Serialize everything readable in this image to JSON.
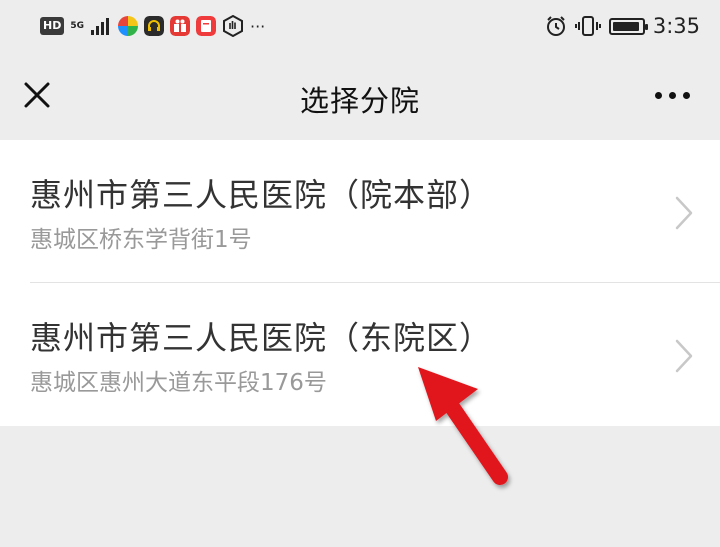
{
  "status_bar": {
    "network_badge": "HD",
    "network_type": "5G",
    "time": "3:35",
    "overflow_glyph": "···",
    "icons": [
      "signal-icon",
      "app-icon-colorful",
      "headphone-app-icon",
      "gift-app-icon",
      "book-app-icon",
      "hand-app-icon",
      "alarm-icon",
      "vibrate-icon",
      "battery-icon"
    ]
  },
  "nav_bar": {
    "title": "选择分院",
    "left_icon": "close-icon",
    "right_icon": "more-icon"
  },
  "branches": [
    {
      "name": "惠州市第三人民医院（院本部）",
      "address": "惠城区桥东学背街1号"
    },
    {
      "name": "惠州市第三人民医院（东院区）",
      "address": "惠城区惠州大道东平段176号"
    }
  ],
  "colors": {
    "background": "#ededed",
    "list_background": "#ffffff",
    "primary_text": "#333333",
    "secondary_text": "#999999",
    "annotation_arrow": "#e0141e"
  }
}
